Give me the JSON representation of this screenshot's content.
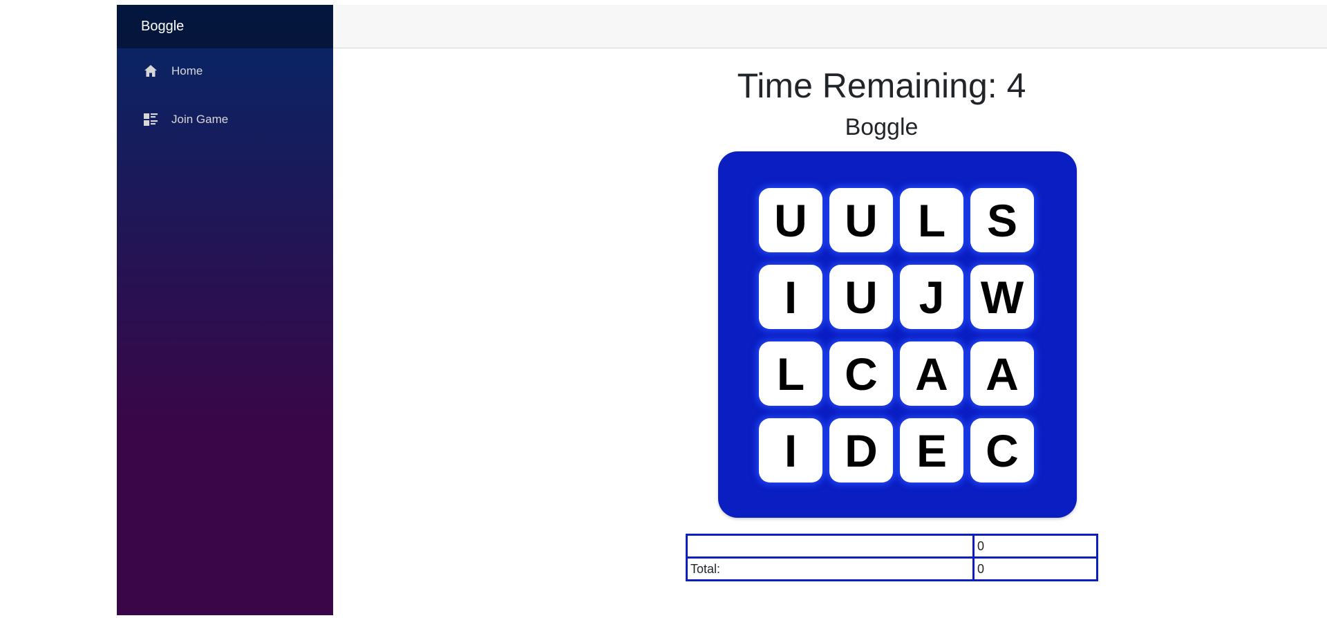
{
  "sidebar": {
    "brand": "Boggle",
    "items": [
      {
        "label": "Home",
        "icon": "home-icon"
      },
      {
        "label": "Join Game",
        "icon": "list-icon"
      }
    ]
  },
  "game": {
    "timer_label": "Time Remaining: 4",
    "title": "Boggle",
    "board": [
      [
        "U",
        "U",
        "L",
        "S"
      ],
      [
        "I",
        "U",
        "J",
        "W"
      ],
      [
        "L",
        "C",
        "A",
        "A"
      ],
      [
        "I",
        "D",
        "E",
        "C"
      ]
    ],
    "scores": {
      "rows": [
        {
          "word": "",
          "score": "0"
        }
      ],
      "total_label": "Total:",
      "total_value": "0"
    }
  },
  "colors": {
    "board": "#0a1ec2",
    "sidebar_top": "#052767",
    "sidebar_bottom": "#3a0647"
  }
}
